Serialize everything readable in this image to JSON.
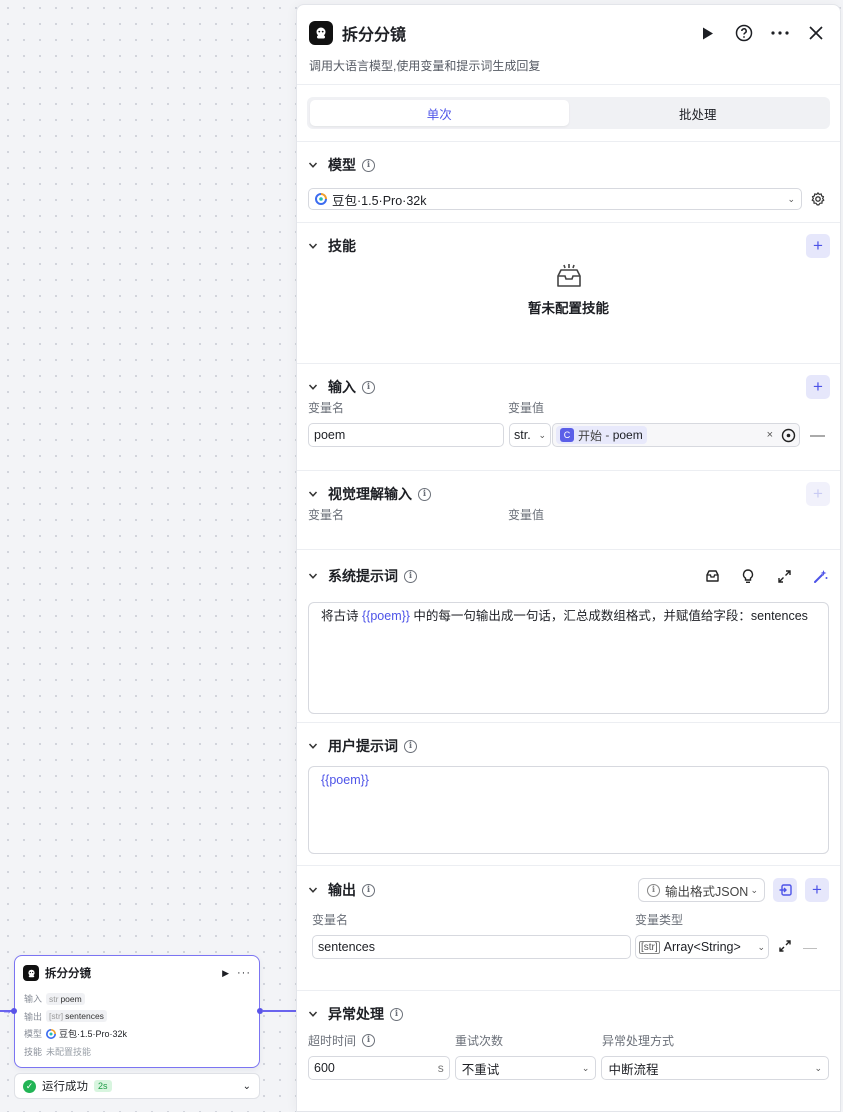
{
  "canvas_node": {
    "title": "拆分分镜",
    "play_icon": "▶",
    "more_icon": "···",
    "rows": [
      {
        "key": "输入",
        "type": "str",
        "value": "poem"
      },
      {
        "key": "输出",
        "type": "[str]",
        "value": "sentences"
      },
      {
        "key": "模型",
        "value": "豆包·1.5·Pro·32k"
      },
      {
        "key": "技能",
        "value": "未配置技能"
      }
    ],
    "status": {
      "text": "运行成功",
      "time": "2s"
    }
  },
  "panel": {
    "title": "拆分分镜",
    "description": "调用大语言模型,使用变量和提示词生成回复",
    "tabs": [
      "单次",
      "批处理"
    ],
    "model": {
      "title": "模型",
      "selected": "豆包·1.5·Pro·32k"
    },
    "skills": {
      "title": "技能",
      "empty_text": "暂未配置技能"
    },
    "input": {
      "title": "输入",
      "col_name": "变量名",
      "col_value": "变量值",
      "row": {
        "name": "poem",
        "type": "str.",
        "ref_source": "开始",
        "ref_sep": "-",
        "ref_var": "poem"
      }
    },
    "vision_input": {
      "title": "视觉理解输入",
      "col_name": "变量名",
      "col_value": "变量值"
    },
    "system_prompt": {
      "title": "系统提示词",
      "before": "将古诗 ",
      "variable": "{{poem}}",
      "after": " 中的每一句输出成一句话，汇总成数组格式，并赋值给字段：sentences"
    },
    "user_prompt": {
      "title": "用户提示词",
      "variable": "{{poem}}"
    },
    "output": {
      "title": "输出",
      "format_label": "输出格式JSON",
      "col_name": "变量名",
      "col_type": "变量类型",
      "row": {
        "name": "sentences",
        "type_prefix": "[str]",
        "type": "Array<String>"
      }
    },
    "exception": {
      "title": "异常处理",
      "timeout_label": "超时时间",
      "timeout_value": "600",
      "timeout_unit": "s",
      "retry_label": "重试次数",
      "retry_value": "不重试",
      "handle_label": "异常处理方式",
      "handle_value": "中断流程"
    }
  },
  "colors": {
    "accent": "#4d53e8",
    "success": "#22b455",
    "node_border": "#7b74f2"
  }
}
